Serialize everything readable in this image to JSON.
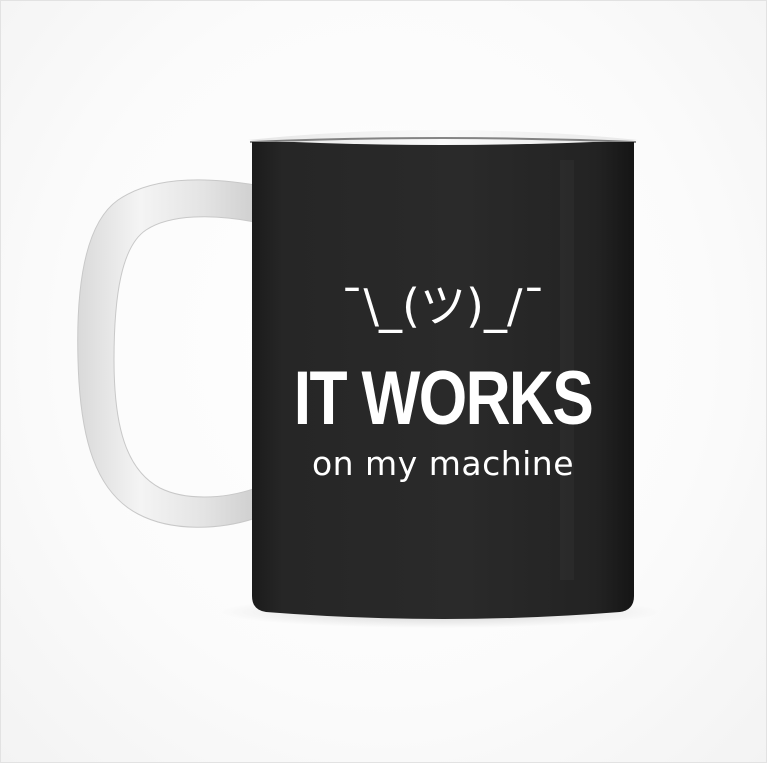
{
  "product": {
    "type": "mug",
    "mug_color": "#262626",
    "print_color": "#ffffff",
    "background_color": "#ffffff",
    "print": {
      "emoticon": "¯\\_(ツ)_/¯",
      "headline": "IT WORKS",
      "subline": "on my machine"
    }
  }
}
